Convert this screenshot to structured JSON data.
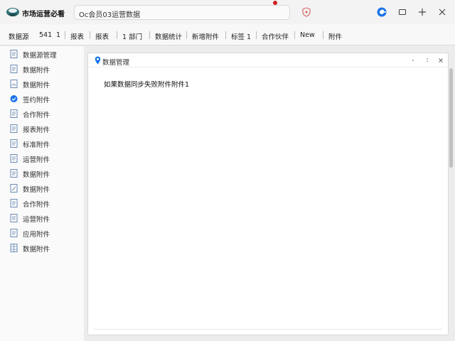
{
  "app": {
    "title": "市场运营必看"
  },
  "search": {
    "value": "Oc会员03运营数据"
  },
  "toolbar": {
    "items": [
      {
        "label": "数据源"
      },
      {
        "label": "541"
      },
      {
        "label": "1"
      },
      {
        "label": "报表"
      },
      {
        "label": "报表"
      },
      {
        "label": "1 部门"
      },
      {
        "label": "数据统计"
      },
      {
        "label": "新增附件"
      },
      {
        "label": "标签 1"
      },
      {
        "label": "合作伙伴"
      },
      {
        "label": "New"
      },
      {
        "label": "附件"
      }
    ]
  },
  "sidebar": {
    "items": [
      {
        "label": "数据源管理",
        "active": false
      },
      {
        "label": "数据附件",
        "active": false
      },
      {
        "label": "数据附件",
        "active": false
      },
      {
        "label": "签约附件",
        "active": true
      },
      {
        "label": "合作附件",
        "active": false
      },
      {
        "label": "报表附件",
        "active": false
      },
      {
        "label": "标准附件",
        "active": false
      },
      {
        "label": "运营附件",
        "active": false
      },
      {
        "label": "数据附件",
        "active": false
      },
      {
        "label": "数据附件",
        "active": false
      },
      {
        "label": "合作附件",
        "active": false
      },
      {
        "label": "运营附件",
        "active": false
      },
      {
        "label": "应用附件",
        "active": false
      },
      {
        "label": "数据附件",
        "active": false
      }
    ]
  },
  "panel": {
    "title": "数据管理",
    "body": "如果数据同步失败附件附件1"
  },
  "colors": {
    "accent": "#1a73e8",
    "notification": "#d0201e"
  }
}
